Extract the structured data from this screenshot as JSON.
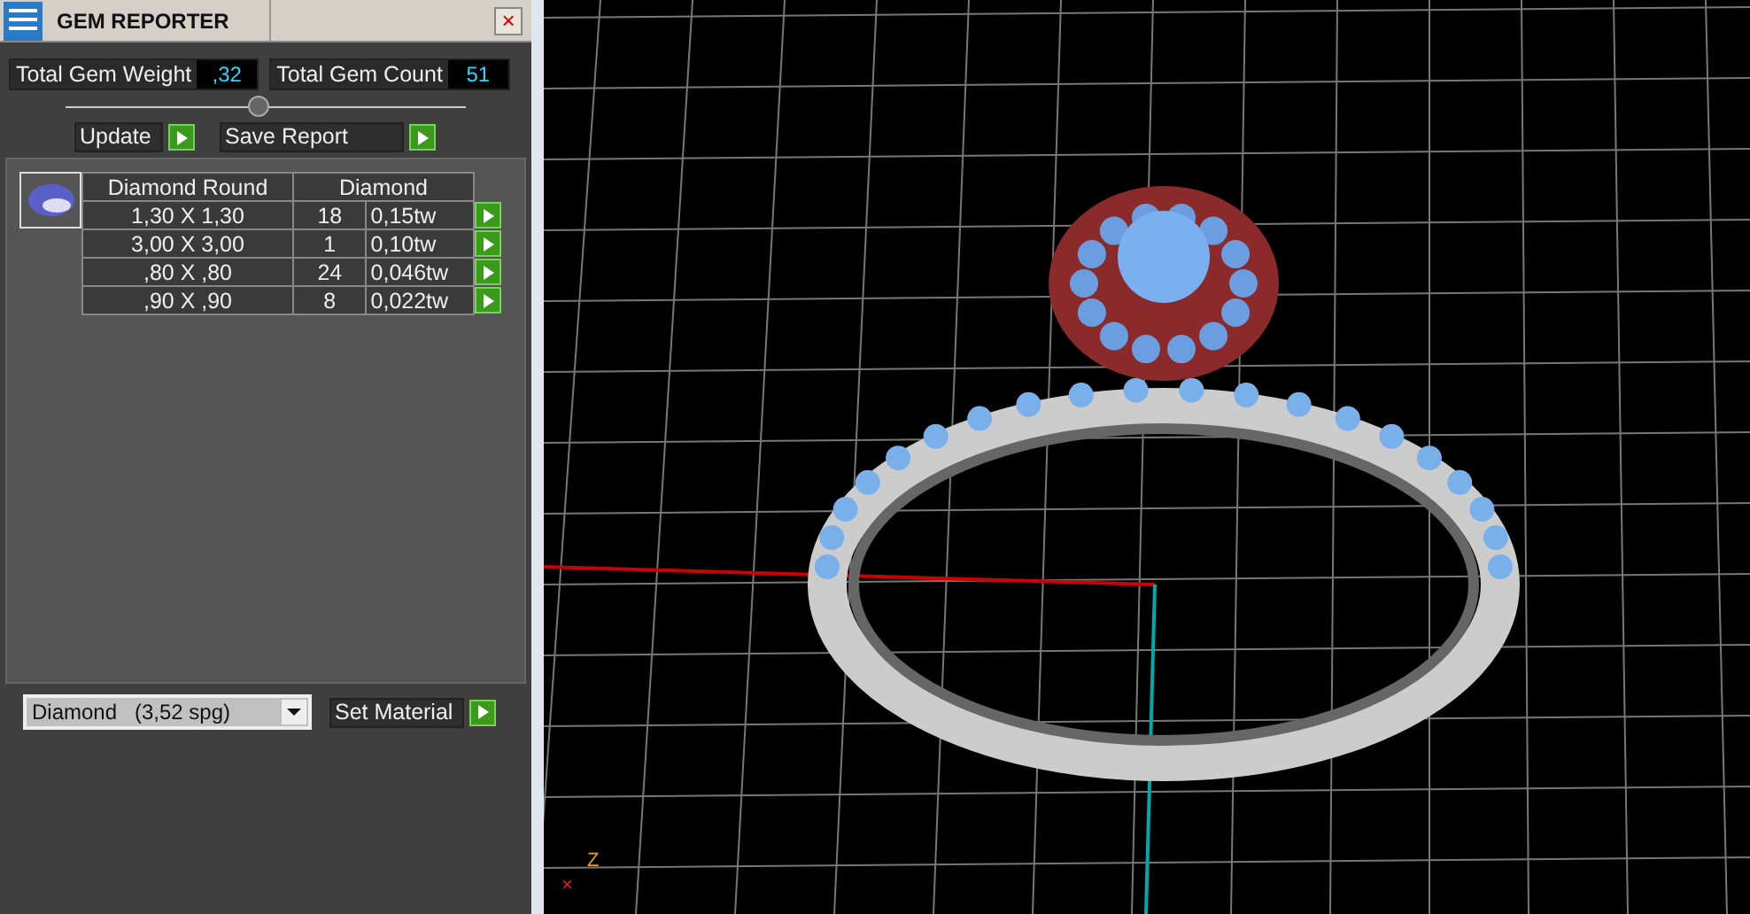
{
  "window": {
    "title": "GEM REPORTER",
    "close": "×"
  },
  "totals": [
    {
      "label": "Total Gem Weight",
      "value": ",32"
    },
    {
      "label": "Total Gem Count",
      "value": "51"
    }
  ],
  "actions": [
    {
      "label": "Update"
    },
    {
      "label": "Save Report"
    }
  ],
  "table": {
    "columns": [
      "Diamond Round",
      "Diamond"
    ],
    "rows": [
      {
        "size": "1,30 X 1,30",
        "count": "18",
        "weight": "0,15tw"
      },
      {
        "size": "3,00 X 3,00",
        "count": "1",
        "weight": "0,10tw"
      },
      {
        "size": ",80 X ,80",
        "count": "24",
        "weight": "0,046tw"
      },
      {
        "size": ",90 X ,90",
        "count": "8",
        "weight": "0,022tw"
      }
    ]
  },
  "material": {
    "name": "Diamond",
    "spg": "(3,52 spg)",
    "button": "Set Material"
  },
  "viewport": {
    "axis_labels": [
      {
        "kind": "x",
        "text": "×"
      },
      {
        "kind": "z",
        "text": "Z"
      }
    ]
  }
}
